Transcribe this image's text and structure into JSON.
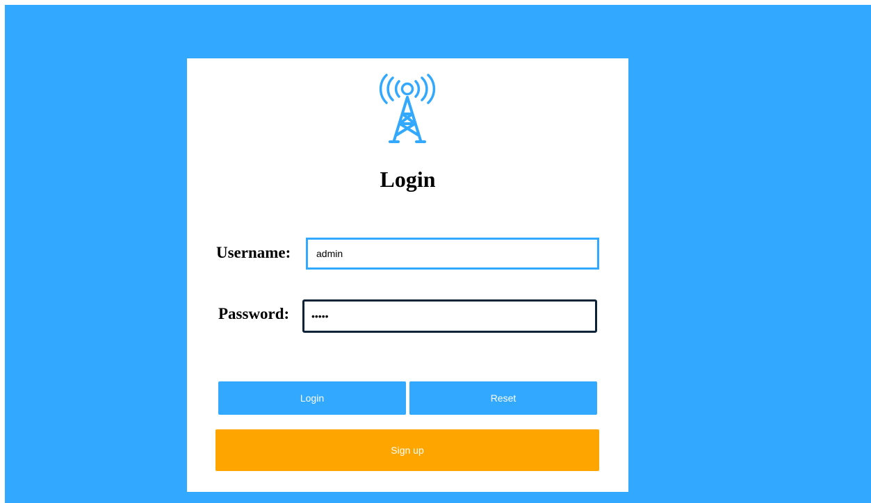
{
  "page": {
    "title": "Login"
  },
  "form": {
    "username_label": "Username:",
    "username_value": "admin",
    "password_label": "Password:",
    "password_value": "•••••"
  },
  "buttons": {
    "login_label": "Login",
    "reset_label": "Reset",
    "signup_label": "Sign up"
  },
  "icons": {
    "logo": "radio-tower-icon"
  },
  "colors": {
    "background": "#33a8ff",
    "card": "#ffffff",
    "primary_button": "#33a8ff",
    "signup_button": "#ffa500",
    "focused_input_border": "#0b2238",
    "input_border": "#33a8ff"
  }
}
